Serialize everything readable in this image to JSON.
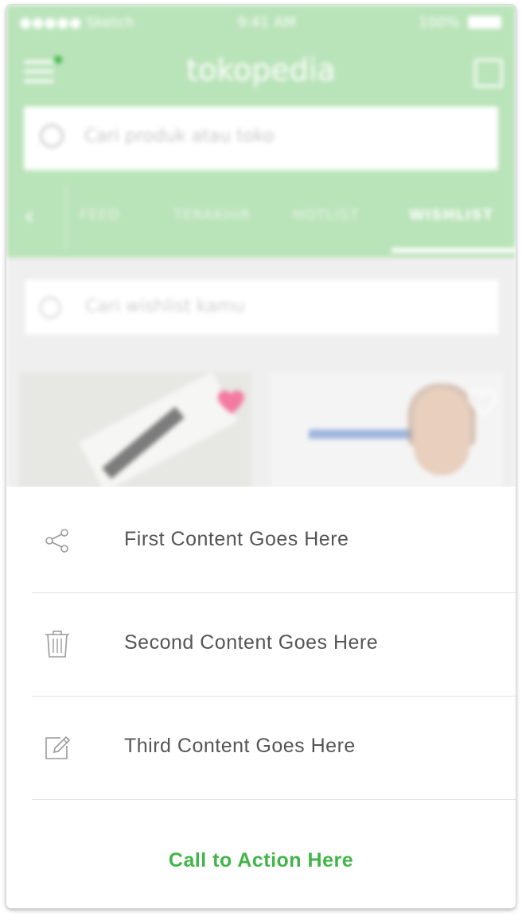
{
  "status_bar": {
    "carrier": "●●●●● Sketch",
    "time": "9:41 AM",
    "battery": "100%"
  },
  "app": {
    "logo": "tokopedia"
  },
  "search": {
    "placeholder": "Cari produk atau toko"
  },
  "tabs": [
    {
      "label": "FEED"
    },
    {
      "label": "TERAKHIR"
    },
    {
      "label": "HOTLIST"
    },
    {
      "label": "WISHLIST"
    }
  ],
  "wishlist_search": {
    "placeholder": "Cari wishlist kamu"
  },
  "sheet": {
    "items": [
      {
        "label": "First Content Goes Here",
        "icon": "share-icon"
      },
      {
        "label": "Second Content Goes Here",
        "icon": "trash-icon"
      },
      {
        "label": "Third Content Goes Here",
        "icon": "edit-icon"
      }
    ],
    "cta": "Call to Action Here"
  },
  "colors": {
    "header_green": "#b9e3b9",
    "accent_green": "#42b549",
    "heart_pink": "#f47aa0",
    "text_gray": "#555555"
  }
}
